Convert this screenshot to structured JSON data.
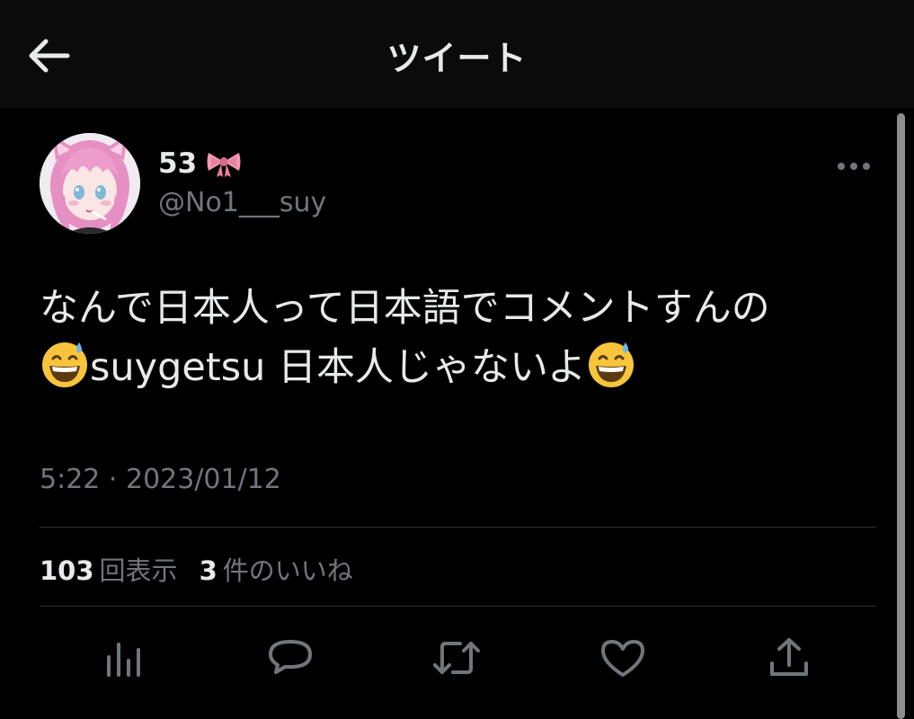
{
  "header": {
    "title": "ツイート",
    "back_icon": "arrow-left-icon"
  },
  "author": {
    "display_name": "53",
    "name_emoji": "ribbon-emoji",
    "handle": "@No1___suy",
    "avatar": "anime-girl-avatar"
  },
  "tweet": {
    "line1": "なんで日本人って日本語でコメントすんの",
    "line2_text": "suygetsu 日本人じゃないよ",
    "emoji": "grinning-sweat-emoji",
    "timestamp": "5:22 · 2023/01/12"
  },
  "stats": {
    "views_count": "103",
    "views_label": "回表示",
    "likes_count": "3",
    "likes_label": "件のいいね"
  },
  "actions": [
    {
      "icon": "analytics-icon"
    },
    {
      "icon": "reply-icon"
    },
    {
      "icon": "retweet-icon"
    },
    {
      "icon": "like-icon"
    },
    {
      "icon": "share-icon"
    }
  ],
  "colors": {
    "background": "#000000",
    "header_background": "#0b0b0b",
    "primary_text": "#e7e9ea",
    "secondary_text": "#71767b",
    "divider": "#2f3336"
  }
}
